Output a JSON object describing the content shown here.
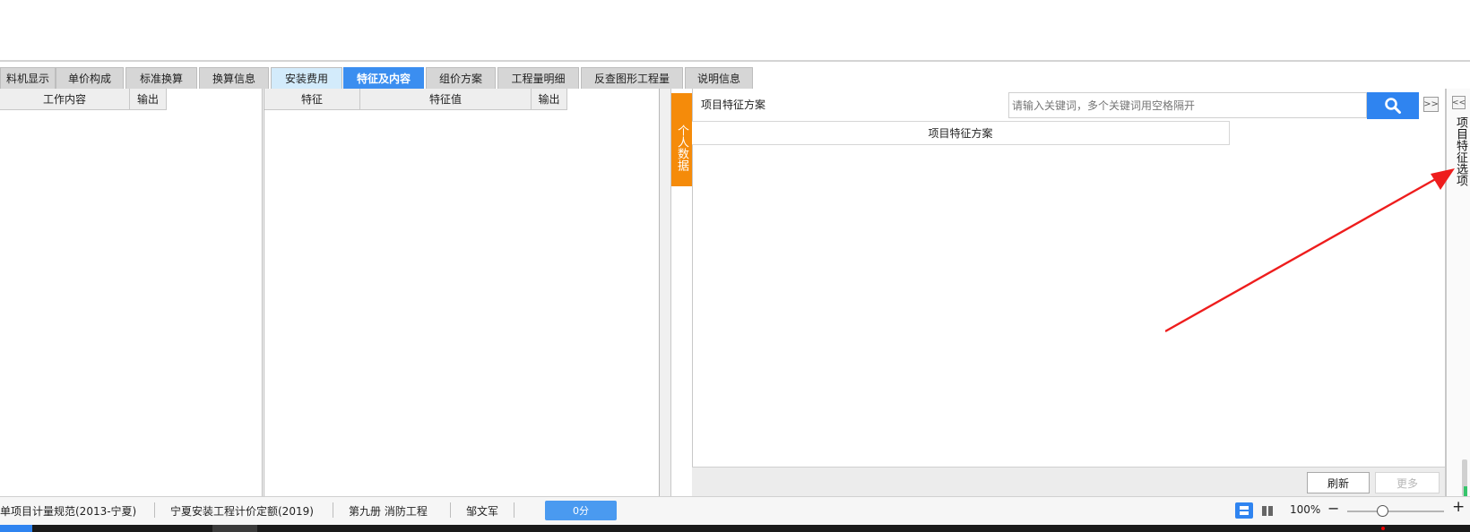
{
  "tabs": [
    {
      "label": "料机显示",
      "state": "normal"
    },
    {
      "label": "单价构成",
      "state": "normal"
    },
    {
      "label": "标准换算",
      "state": "normal"
    },
    {
      "label": "换算信息",
      "state": "normal"
    },
    {
      "label": "安装费用",
      "state": "light"
    },
    {
      "label": "特征及内容",
      "state": "active"
    },
    {
      "label": "组价方案",
      "state": "normal"
    },
    {
      "label": "工程量明细",
      "state": "normal"
    },
    {
      "label": "反查图形工程量",
      "state": "normal"
    },
    {
      "label": "说明信息",
      "state": "normal"
    }
  ],
  "left_panel": {
    "headers": [
      "工作内容",
      "输出"
    ]
  },
  "mid_panel": {
    "headers": [
      "特征",
      "特征值",
      "输出"
    ]
  },
  "personal_data_tab": "个人数据",
  "right_panel": {
    "title": "项目特征方案",
    "search_placeholder": "请输入关键词，多个关键词用空格隔开",
    "table_header": "项目特征方案",
    "refresh_label": "刷新",
    "more_label": "更多",
    "expand_label": ">>"
  },
  "right_strip": {
    "collapse_label": "<<",
    "side_label": "项目特征选项"
  },
  "status_bar": {
    "items": [
      "单项目计量规范(2013-宁夏)",
      "宁夏安装工程计价定额(2019)",
      "第九册 消防工程",
      "邹文军"
    ],
    "score": "0分",
    "zoom": "100%",
    "minus": "−",
    "plus": "+"
  },
  "colors": {
    "active_tab": "#3b8ef0",
    "accent_orange": "#f58b0a",
    "arrow_red": "#ee1d1d"
  }
}
